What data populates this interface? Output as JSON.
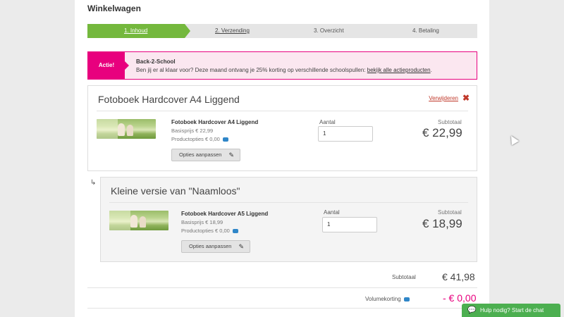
{
  "header": {
    "title": "Winkelwagen"
  },
  "steps": [
    "1. Inhoud",
    "2. Verzending",
    "3. Overzicht",
    "4. Betaling"
  ],
  "promo": {
    "tag": "Actie!",
    "title": "Back-2-School",
    "text": "Ben jij er al klaar voor? Deze maand ontvang je 25% korting op verschillende schoolspullen: ",
    "link": "bekijk alle actieproducten",
    "suffix": "."
  },
  "items": [
    {
      "heading": "Fotoboek Hardcover A4 Liggend",
      "remove": "Verwijderen",
      "name": "Fotoboek Hardcover A4 Liggend",
      "base_price": "Basisprijs € 22,99",
      "options_price": "Productopties € 0,00",
      "options_button": "Opties aanpassen",
      "qty_label": "Aantal",
      "qty": "1",
      "subtotal_label": "Subtotaal",
      "subtotal": "€ 22,99"
    },
    {
      "heading": "Kleine versie van \"Naamloos\"",
      "name": "Fotoboek Hardcover A5 Liggend",
      "base_price": "Basisprijs € 18,99",
      "options_price": "Productopties € 0,00",
      "options_button": "Opties aanpassen",
      "qty_label": "Aantal",
      "qty": "1",
      "subtotal_label": "Subtotaal",
      "subtotal": "€ 18,99"
    }
  ],
  "totals": {
    "subtotal_label": "Subtotaal",
    "subtotal": "€ 41,98",
    "discount_label": "Volumekorting",
    "discount": "- € 0,00"
  },
  "chat": {
    "label": "Hulp nodig? Start de chat"
  },
  "colors": {
    "accent_green": "#74b83d",
    "promo_pink": "#e8007e",
    "remove_red": "#c0392b"
  }
}
